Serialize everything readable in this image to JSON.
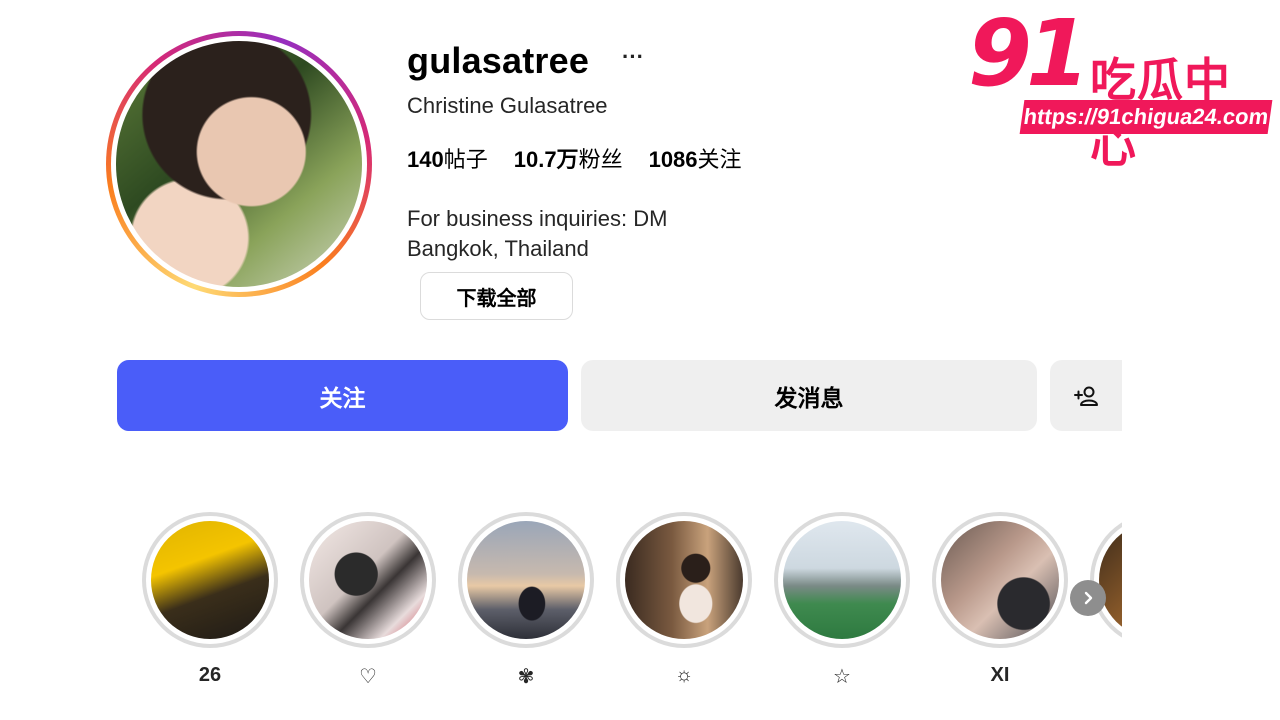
{
  "profile": {
    "username": "gulasatree",
    "more_glyph": "···",
    "full_name": "Christine Gulasatree",
    "stats": [
      {
        "value": "140",
        "label": "帖子"
      },
      {
        "value": "10.7万",
        "label": "粉丝"
      },
      {
        "value": "1086",
        "label": "关注"
      }
    ],
    "bio_lines": [
      "For business inquiries: DM",
      "Bangkok, Thailand"
    ],
    "download_all_label": "下载全部"
  },
  "actions": {
    "follow_label": "关注",
    "message_label": "发消息",
    "follow_color": "#4a5df9"
  },
  "highlights": [
    {
      "label": "26"
    },
    {
      "label": "♡"
    },
    {
      "label": "✾"
    },
    {
      "label": "☼"
    },
    {
      "label": "☆"
    },
    {
      "label": "XI"
    }
  ],
  "watermark": {
    "number": "91",
    "text": "吃瓜中心",
    "url": "https://91chigua24.com",
    "color": "#f0185a"
  }
}
